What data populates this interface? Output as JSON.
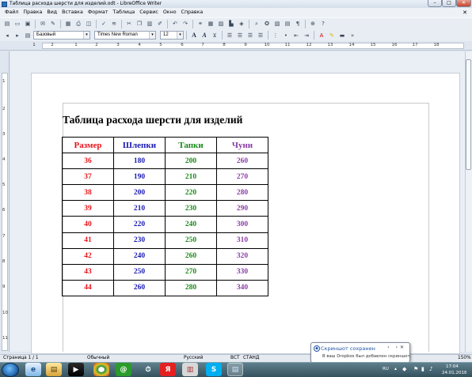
{
  "window": {
    "title": "Таблица расхода шерсти для изделий.odt - LibreOffice Writer",
    "buttons": {
      "minimize": "–",
      "maximize": "□",
      "close": "✕"
    }
  },
  "menu": {
    "items": [
      "Файл",
      "Правка",
      "Вид",
      "Вставка",
      "Формат",
      "Таблица",
      "Сервис",
      "Окно",
      "Справка"
    ],
    "close": "✕"
  },
  "formatting": {
    "style": "Базовый",
    "font": "Times New Roman",
    "size": "12",
    "bold": "A",
    "italic": "A"
  },
  "ruler": {
    "h": [
      "1",
      "2",
      "1",
      "1",
      "2",
      "3",
      "4",
      "5",
      "6",
      "7",
      "8",
      "9",
      "10",
      "11",
      "12",
      "13",
      "14",
      "15",
      "16",
      "17",
      "18"
    ],
    "v": [
      "1",
      "2",
      "3",
      "4",
      "5",
      "6",
      "7",
      "8",
      "9",
      "10",
      "11"
    ]
  },
  "document": {
    "title": "Таблица расхода шерсти для изделий",
    "headers": [
      "Размер",
      "Шлепки",
      "Тапки",
      "Чуни"
    ],
    "rows": [
      [
        "36",
        "180",
        "200",
        "260"
      ],
      [
        "37",
        "190",
        "210",
        "270"
      ],
      [
        "38",
        "200",
        "220",
        "280"
      ],
      [
        "39",
        "210",
        "230",
        "290"
      ],
      [
        "40",
        "220",
        "240",
        "300"
      ],
      [
        "41",
        "230",
        "250",
        "310"
      ],
      [
        "42",
        "240",
        "260",
        "320"
      ],
      [
        "43",
        "250",
        "270",
        "330"
      ],
      [
        "44",
        "260",
        "280",
        "340"
      ]
    ],
    "colors": [
      "#e8141a",
      "#1a1ab4",
      "#1a8a1a",
      "#8a3ea6"
    ]
  },
  "status": {
    "page": "Страница 1 / 1",
    "style": "Обычный",
    "language": "Русский",
    "insert": "ВСТ",
    "selection": "СТАНД",
    "zoom": "150%"
  },
  "notification": {
    "title": "Скриншот сохранен",
    "body": "В ваш Dropbox был добавлен скриншот."
  },
  "taskbar": {
    "lang": "RU",
    "time": "17:04",
    "date": "24.01.2016"
  }
}
